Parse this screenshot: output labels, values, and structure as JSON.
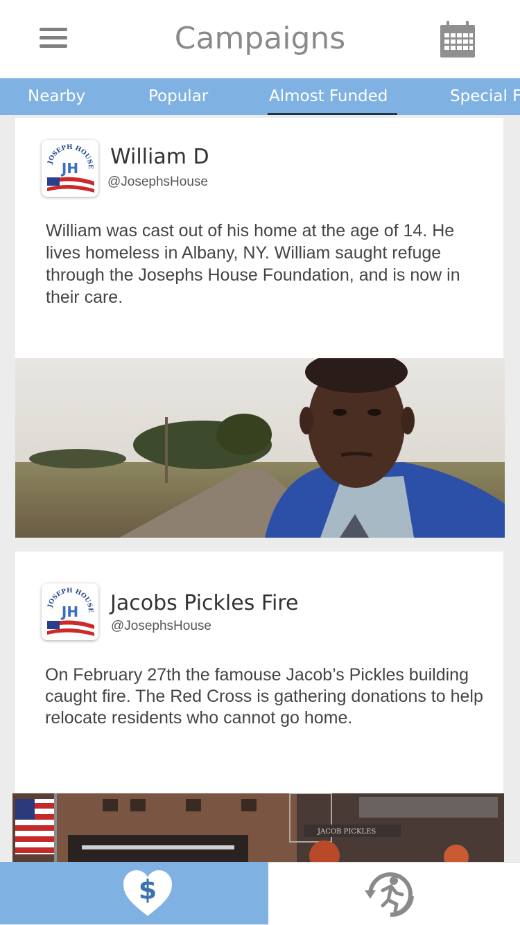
{
  "header": {
    "title": "Campaigns",
    "menu_icon": "hamburger-menu-icon",
    "calendar_icon": "calendar-icon"
  },
  "tabs": [
    {
      "label": "Nearby",
      "active": false
    },
    {
      "label": "Popular",
      "active": false
    },
    {
      "label": "Almost Funded",
      "active": true
    },
    {
      "label": "Special Fo",
      "active": false
    }
  ],
  "campaigns": [
    {
      "name": "William D",
      "handle": "@JosephsHouse",
      "description": "William was cast out of his home at the age of 14. He lives homeless in Albany, NY. William saught refuge through the Josephs House Foundation, and is now in their care.",
      "logo_text": "JOSEPH HOUSE",
      "logo_initials": "JH"
    },
    {
      "name": "Jacobs Pickles Fire",
      "handle": "@JosephsHouse",
      "description": "On February 27th the famouse Jacob’s Pickles building caught fire. The Red Cross is gathering donations to help relocate residents who cannot go home.",
      "logo_text": "JOSEPH HOUSE",
      "logo_initials": "JH"
    }
  ],
  "bottom_nav": {
    "donate_icon": "heart-dollar-icon",
    "donate_symbol": "$",
    "activity_icon": "running-person-icon"
  },
  "colors": {
    "tab_bar": "#7fb2e3",
    "active_underline": "#20344a",
    "title_gray": "#8a8a8a"
  }
}
